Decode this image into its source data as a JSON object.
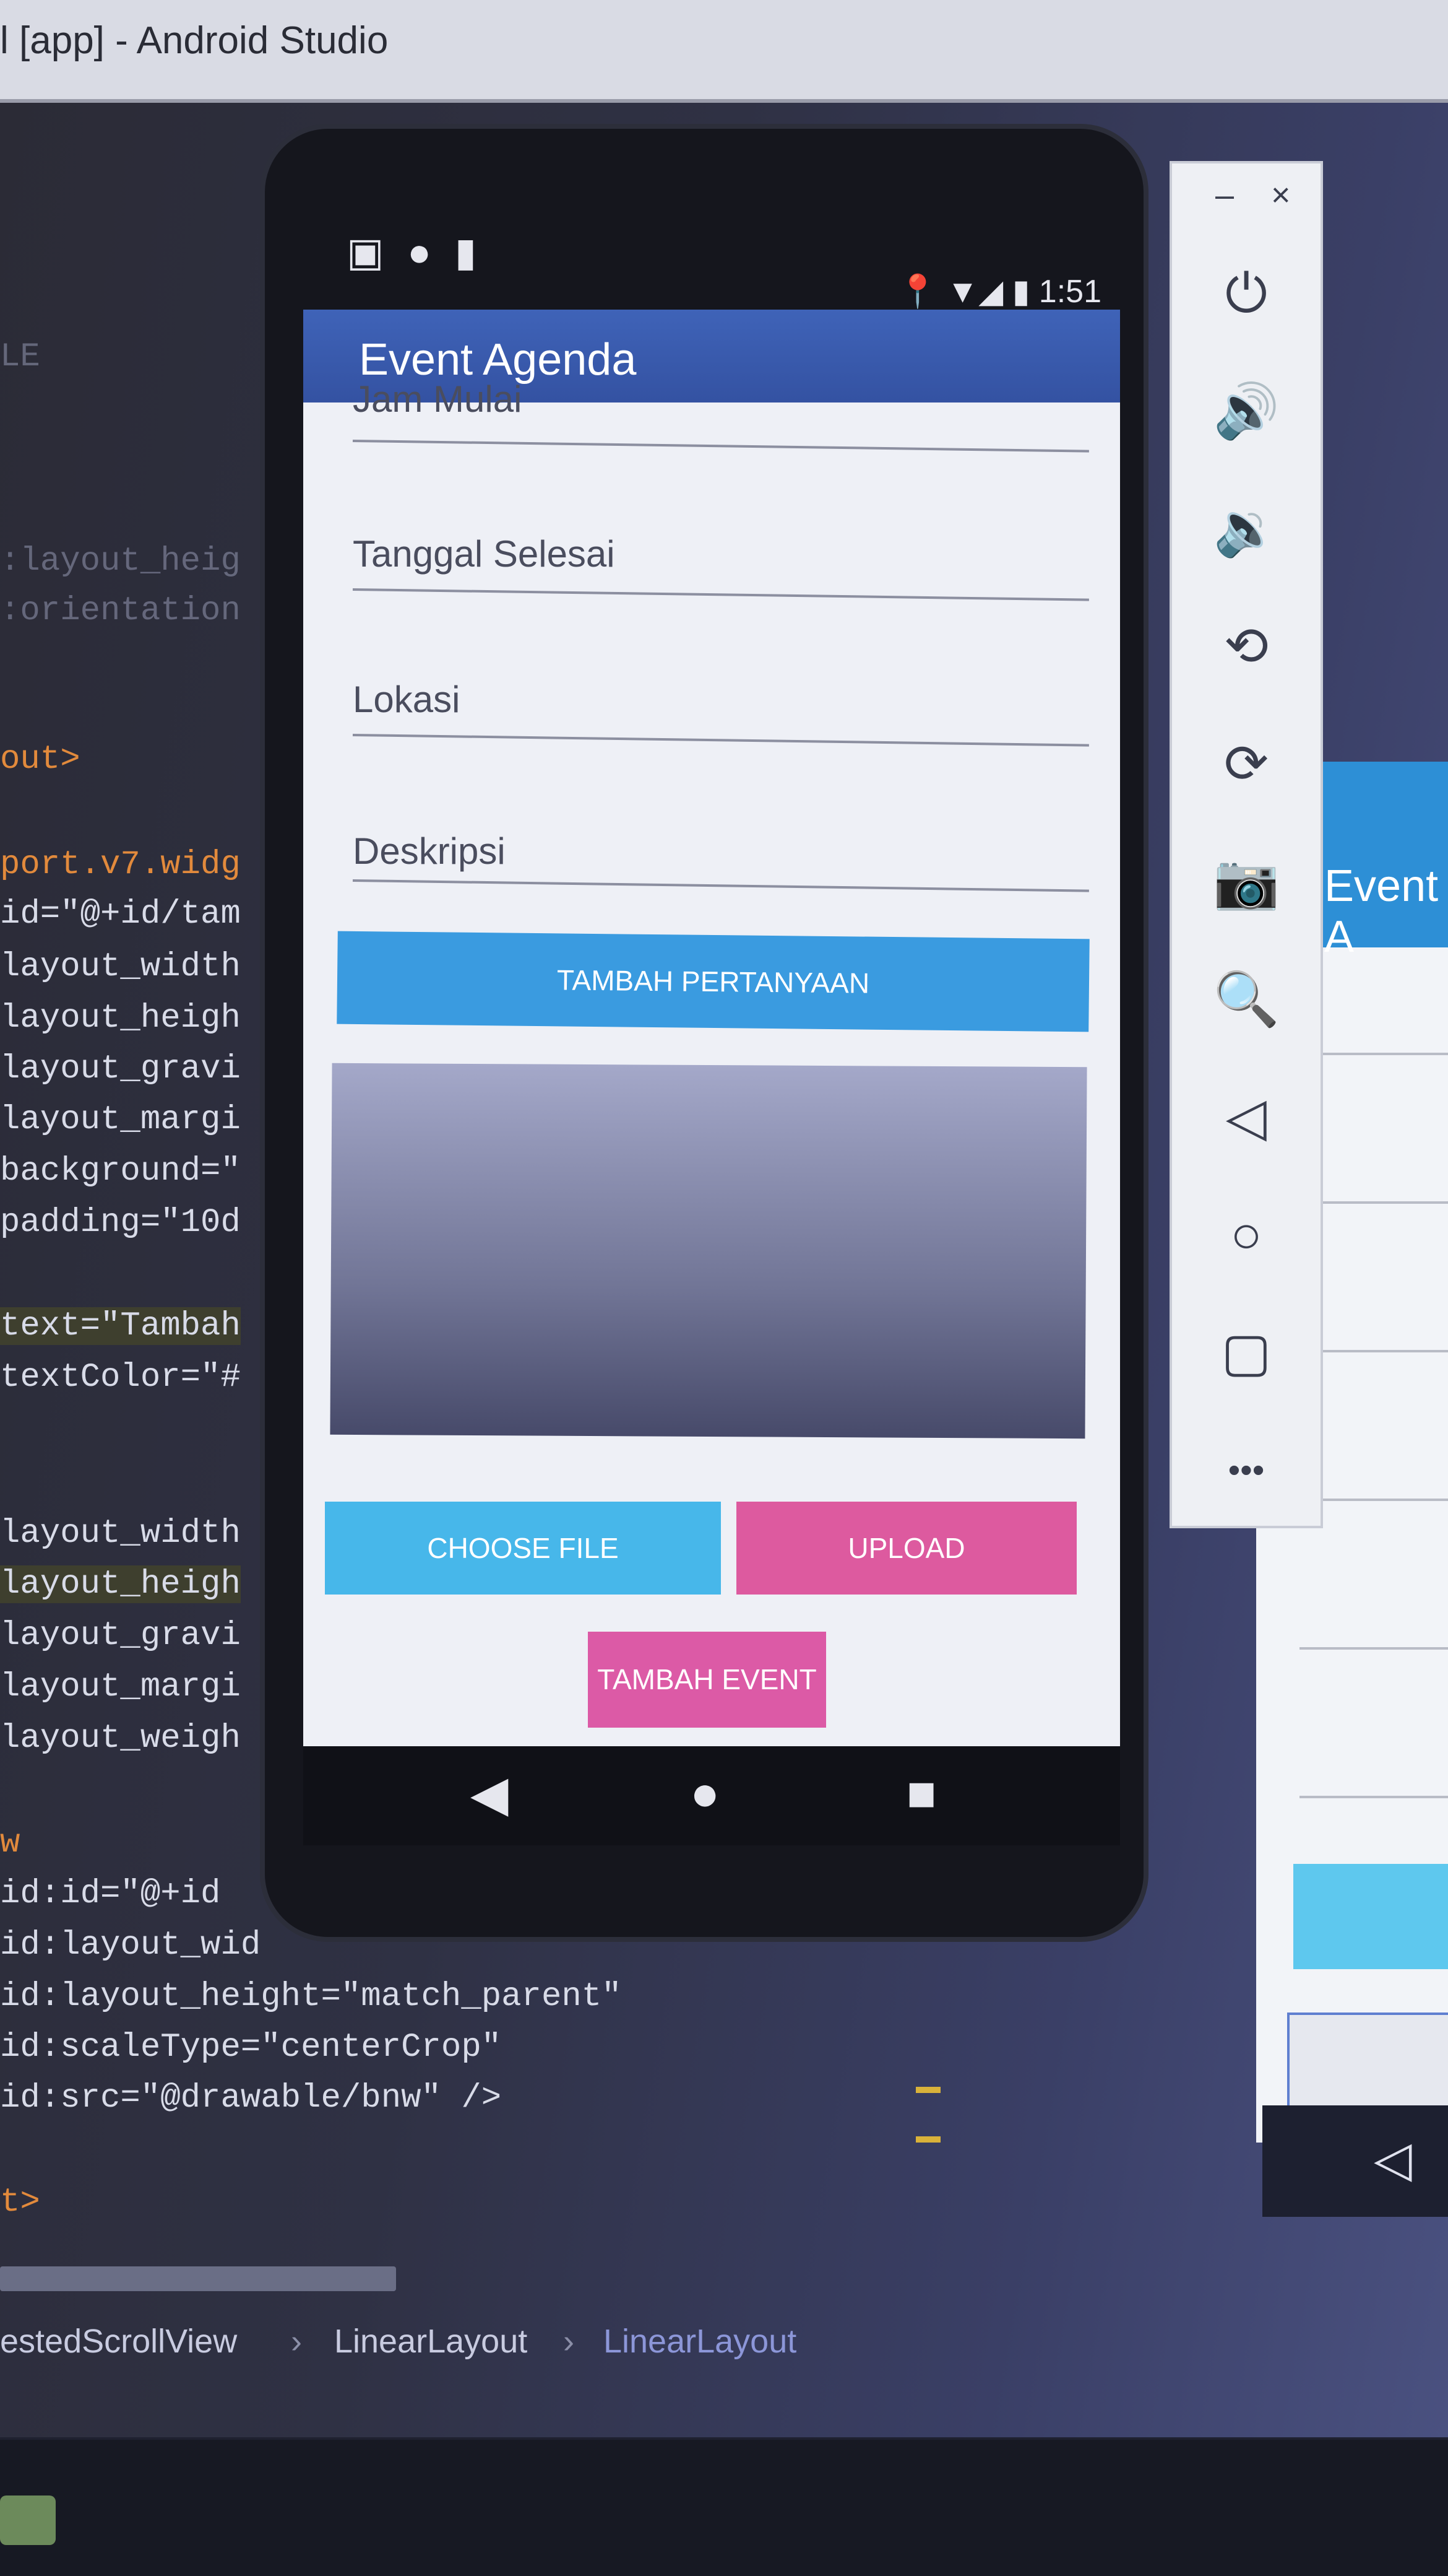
{
  "window": {
    "title": "l [app] - Android Studio"
  },
  "editor": {
    "lines": [
      {
        "text": "LE",
        "style": "dim"
      },
      {
        "text": ":layout_heig",
        "style": "dim"
      },
      {
        "text": ":orientation",
        "style": "dim"
      },
      {
        "text": "out>",
        "style": "orange"
      },
      {
        "text": "port.v7.widg",
        "style": "orange"
      },
      {
        "text": "id=\"@+id/tam",
        "style": "normal"
      },
      {
        "text": "layout_width",
        "style": "normal"
      },
      {
        "text": "layout_heigh",
        "style": "normal"
      },
      {
        "text": "layout_gravi",
        "style": "normal"
      },
      {
        "text": "layout_margi",
        "style": "normal"
      },
      {
        "text": "background=\"",
        "style": "normal"
      },
      {
        "text": "padding=\"10d",
        "style": "normal"
      },
      {
        "text": "text=\"Tambah",
        "style": "hl"
      },
      {
        "text": "textColor=\"#",
        "style": "normal"
      },
      {
        "text": "layout_width",
        "style": "normal"
      },
      {
        "text": "layout_heigh",
        "style": "hl"
      },
      {
        "text": "layout_gravi",
        "style": "normal"
      },
      {
        "text": "layout_margi",
        "style": "normal"
      },
      {
        "text": "layout_weigh",
        "style": "normal"
      },
      {
        "text": "w",
        "style": "orange"
      },
      {
        "text": "id:id=\"@+id",
        "style": "normal"
      },
      {
        "text": "id:layout_wid",
        "style": "normal"
      },
      {
        "text": "id:layout_height=\"match_parent\"",
        "style": "normal"
      },
      {
        "text": "id:scaleType=\"centerCrop\"",
        "style": "normal"
      },
      {
        "text": "id:src=\"@drawable/bnw\" />",
        "style": "normal"
      },
      {
        "text": "t>",
        "style": "orange"
      }
    ],
    "breadcrumb": [
      "estedScrollView",
      "LinearLayout",
      "LinearLayout"
    ]
  },
  "preview_panel": {
    "title": "Event A"
  },
  "emulator_toolbar": {
    "minimize": "–",
    "close": "×",
    "tools": [
      {
        "name": "power-icon",
        "glyph": "⏻"
      },
      {
        "name": "volume-up-icon",
        "glyph": "🔊"
      },
      {
        "name": "volume-down-icon",
        "glyph": "🔉"
      },
      {
        "name": "rotate-left-icon",
        "glyph": "⟲"
      },
      {
        "name": "rotate-right-icon",
        "glyph": "⟳"
      },
      {
        "name": "camera-icon",
        "glyph": "📷"
      },
      {
        "name": "zoom-icon",
        "glyph": "🔍"
      },
      {
        "name": "back-icon",
        "glyph": "◁"
      },
      {
        "name": "home-icon",
        "glyph": "○"
      },
      {
        "name": "overview-icon",
        "glyph": "▢"
      },
      {
        "name": "more-icon",
        "glyph": "•••"
      }
    ]
  },
  "phone": {
    "status_left": "▣ ● ▮",
    "status_right": "📍 ▼◢ ▮ 1:51",
    "app_title": "Event Agenda",
    "fields": [
      {
        "label": "Jam Mulai"
      },
      {
        "label": "Tanggal Selesai"
      },
      {
        "label": "Lokasi"
      },
      {
        "label": "Deskripsi"
      }
    ],
    "buttons": {
      "tambah_pertanyaan": "TAMBAH PERTANYAAN",
      "choose_file": "CHOOSE FILE",
      "upload": "UPLOAD",
      "tambah_event": "TAMBAH EVENT"
    },
    "nav": {
      "back": "◀",
      "home": "●",
      "recent": "■"
    }
  },
  "colors": {
    "app_bar": "#3452a2",
    "primary_button": "#3a9be0",
    "choose_file_button": "#47b7ea",
    "accent_button": "#dd5a9f"
  }
}
